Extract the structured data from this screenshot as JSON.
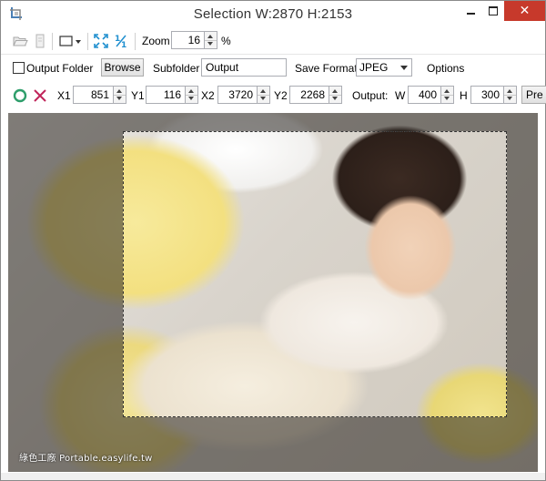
{
  "window": {
    "title": "Selection  W:2870 H:2153",
    "close_glyph": "✕"
  },
  "toolbar": {
    "zoom_label": "Zoom",
    "zoom_value": "16",
    "zoom_unit": "%"
  },
  "options_bar": {
    "output_folder_label": "Output Folder",
    "output_folder_checked": false,
    "browse_label": "Browse",
    "subfolder_label": "Subfolder",
    "subfolder_value": "Output",
    "save_format_label": "Save Format",
    "save_format_value": "JPEG",
    "options_label": "Options"
  },
  "selection_bar": {
    "x1_label": "X1",
    "x1_value": "851",
    "y1_label": "Y1",
    "y1_value": "116",
    "x2_label": "X2",
    "x2_value": "3720",
    "y2_label": "Y2",
    "y2_value": "2268",
    "output_label": "Output:",
    "w_label": "W",
    "w_value": "400",
    "h_label": "H",
    "h_value": "300",
    "preview_label": "Pre"
  },
  "image": {
    "watermark": "綠色工廠 Portable.easylife.tw"
  },
  "colors": {
    "close_button": "#c7392b",
    "accept_icon": "#2e9e6b",
    "cancel_icon": "#c0245a",
    "toolbar_icon": "#1f8fcf"
  }
}
